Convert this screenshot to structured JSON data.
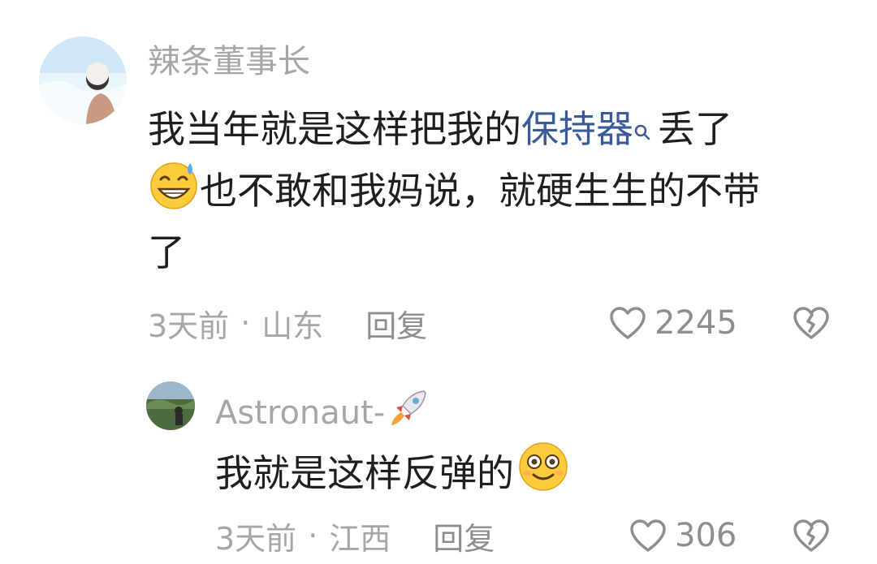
{
  "comments": [
    {
      "username": "辣条董事长",
      "content_lines": [
        {
          "pre": "我当年就是这样把我的",
          "keyword": "保持器",
          "post": "丢了"
        },
        {
          "text": "也不敢和我妈说，就硬生生的不带"
        },
        {
          "text": "了"
        }
      ],
      "emoji_inline": "grinning-sweat-emoji",
      "time": "3天前",
      "location": "山东",
      "reply_label": "回复",
      "likes": "2245",
      "keyword_icon": "search-icon"
    },
    {
      "username": "Astronaut-",
      "username_emoji": "rocket-emoji",
      "content": "我就是这样反弹的",
      "emoji_inline": "flushed-smile-emoji",
      "time": "3天前",
      "location": "江西",
      "reply_label": "回复",
      "likes": "306"
    }
  ],
  "meta_separator": "·",
  "colors": {
    "keyword": "#3b5a9a",
    "muted": "#a6a6a6",
    "text": "#1f1f1f"
  }
}
